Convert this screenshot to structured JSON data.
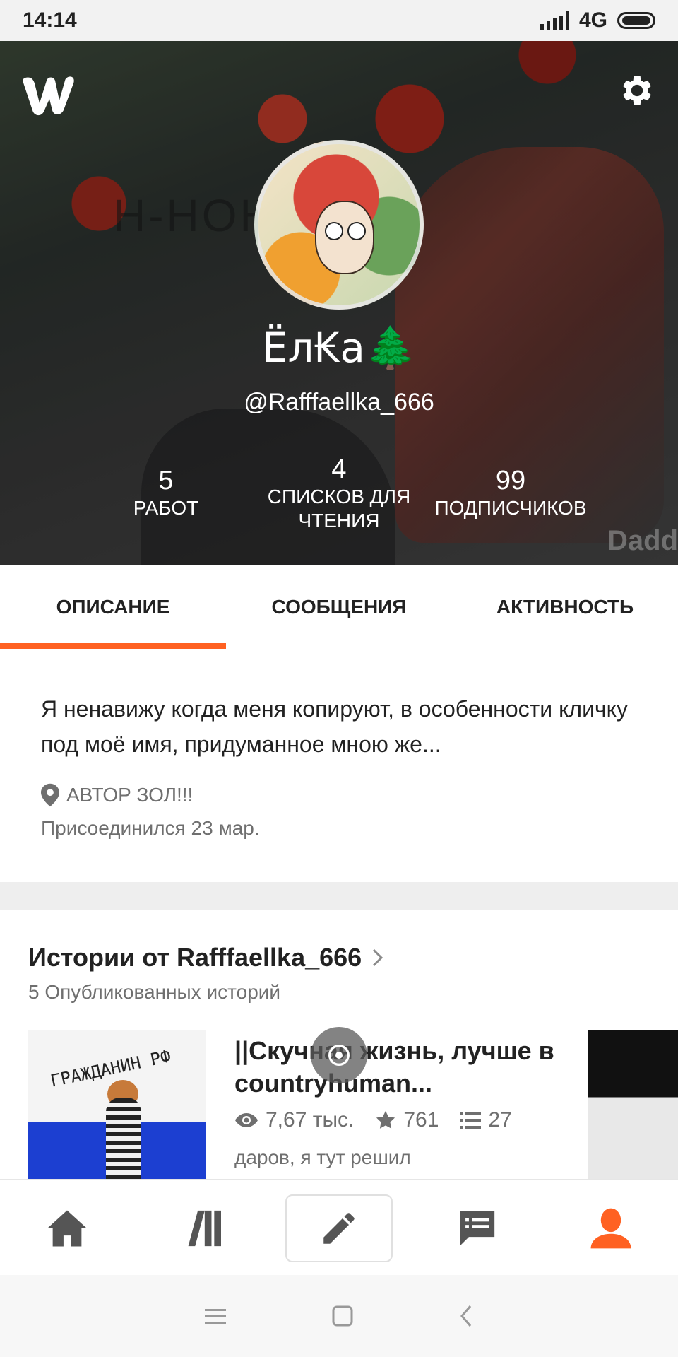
{
  "status_bar": {
    "time": "14:14",
    "network": "4G"
  },
  "header": {
    "app_logo": "wattpad-logo-icon",
    "settings_icon": "gear-icon",
    "display_name": "Ёл₭а🌲",
    "username": "@Rafffaellka_666",
    "art_text": "Н-НОН",
    "watermark": "Dadd",
    "stats": [
      {
        "value": "5",
        "label": "РАБОТ"
      },
      {
        "value": "4",
        "label": "СПИСКОВ ДЛЯ ЧТЕНИЯ"
      },
      {
        "value": "99",
        "label": "ПОДПИСЧИКОВ"
      }
    ]
  },
  "tabs": [
    {
      "label": "ОПИСАНИЕ",
      "active": true
    },
    {
      "label": "СООБЩЕНИЯ",
      "active": false
    },
    {
      "label": "АКТИВНОСТЬ",
      "active": false
    }
  ],
  "about": {
    "description": "Я ненавижу когда меня копируют, в особенности кличку под моё имя, придуманное мною же...",
    "location": "АВТОР ЗОЛ!!!",
    "joined": "Присоединился 23 мар."
  },
  "stories": {
    "title": "Истории от Rafffaellka_666",
    "subtitle": "5 Опубликованных историй",
    "items": [
      {
        "title": "||Скучная жизнь, лучше в countryhuman...",
        "views": "7,67 тыс.",
        "votes": "761",
        "parts": "27",
        "description": "даров, я тут решил",
        "cover_text": "ГРАЖДАНИН РФ"
      }
    ]
  },
  "bottom_nav": [
    "home-icon",
    "library-icon",
    "write-icon",
    "messages-icon",
    "profile-icon"
  ],
  "colors": {
    "accent": "#ff6122",
    "text": "#222222",
    "muted": "#6f6f6f",
    "divider": "#eeeeee"
  }
}
